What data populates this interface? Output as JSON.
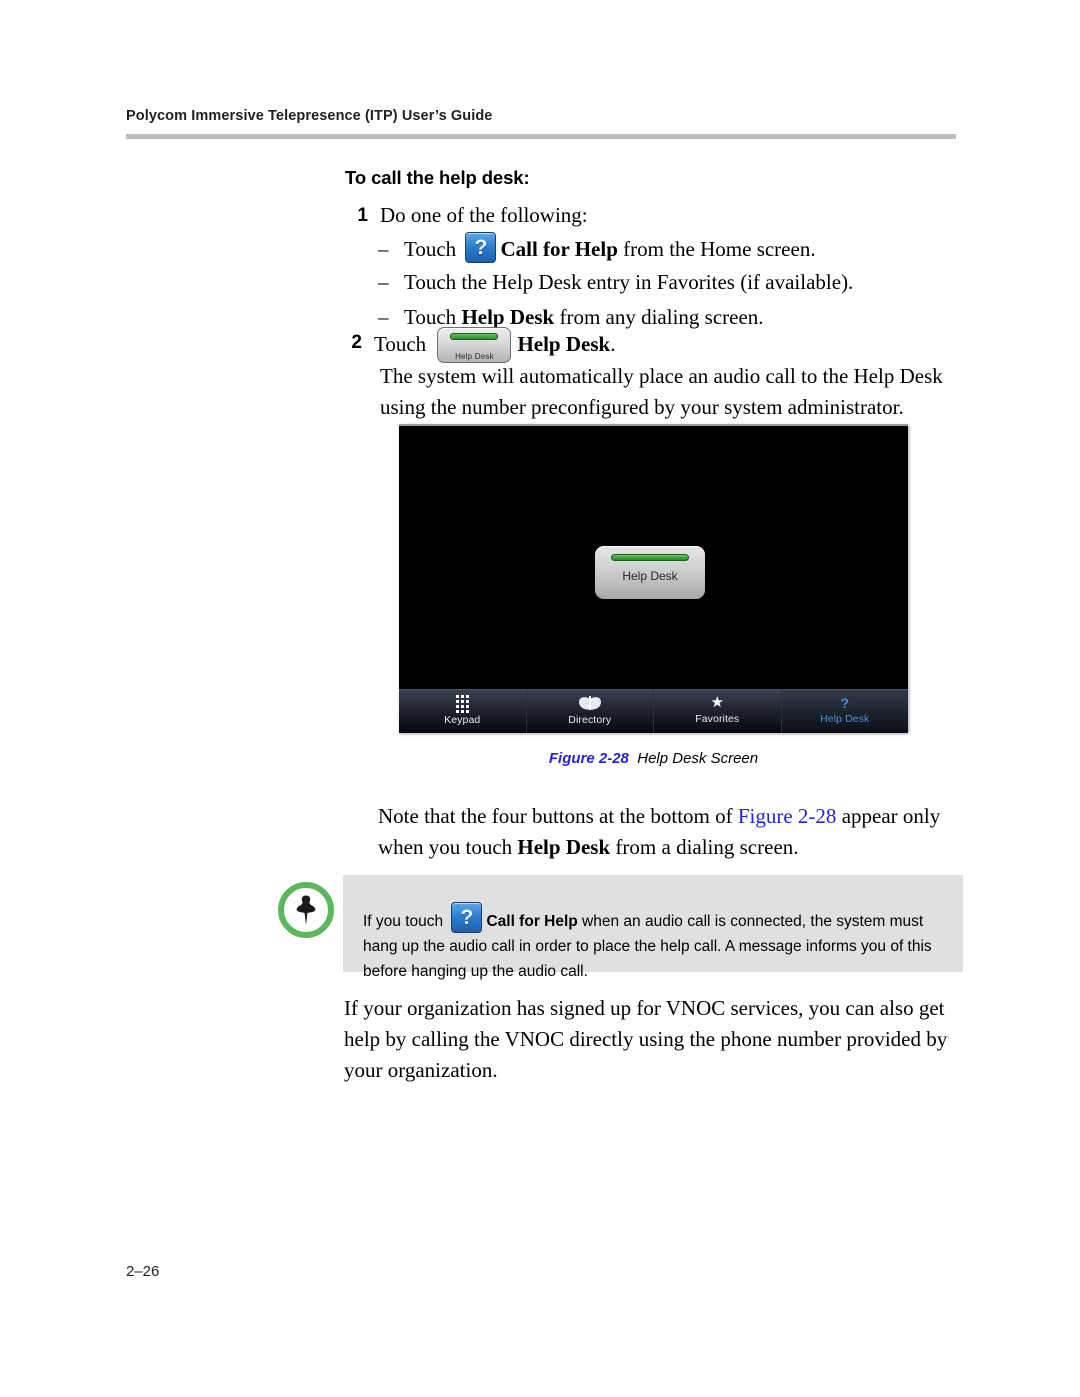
{
  "header": {
    "running_head": "Polycom Immersive Telepresence (ITP) User’s Guide"
  },
  "section": {
    "title": "To call the help desk:"
  },
  "steps": [
    {
      "number": "1",
      "text": "Do one of the following:",
      "sub_items": [
        {
          "dash": "–",
          "before_icon": "Touch ",
          "icon": "help-question-icon",
          "bold_text": "Call for Help",
          "after": " from the Home screen."
        },
        {
          "dash": "–",
          "text": "Touch the Help Desk entry in Favorites (if available)."
        },
        {
          "dash": "–",
          "before": "Touch ",
          "bold_text": "Help Desk",
          "after": " from any dialing screen."
        }
      ]
    },
    {
      "number": "2",
      "before_icon": "Touch ",
      "icon": "help-desk-button-icon",
      "icon_label": "Help Desk",
      "bold_text": "Help Desk",
      "after": ".",
      "body": "The system will automatically place an audio call to the Help Desk using the number preconfigured by your system administrator."
    }
  ],
  "figure": {
    "screen": {
      "help_desk_button_label": "Help Desk",
      "toolbar": [
        {
          "label": "Keypad",
          "icon": "keypad-grid-icon",
          "active": false
        },
        {
          "label": "Directory",
          "icon": "directory-book-icon",
          "active": false
        },
        {
          "label": "Favorites",
          "icon": "star-icon",
          "active": false
        },
        {
          "label": "Help Desk",
          "icon": "question-mark-icon",
          "active": true
        }
      ]
    },
    "caption_number": "Figure 2-28",
    "caption_title": "Help Desk Screen"
  },
  "body_paragraphs": {
    "note_about_buttons": {
      "part1": "Note that the four buttons at the bottom of ",
      "xref": "Figure 2-28",
      "part2": " appear only when you touch ",
      "bold": "Help Desk",
      "part3": " from a dialing screen."
    },
    "vnoc": "If your organization has signed up for VNOC services, you can also get help by calling the VNOC directly using the phone number provided by your organization."
  },
  "note_box": {
    "icon": "pushpin-note-icon",
    "accent_color": "#5cb85c",
    "background_color": "#e0e0e0",
    "part1": "If you touch ",
    "icon_inline": "help-question-icon",
    "bold": "Call for Help",
    "part2": " when an audio call is connected, the system must hang up the audio call in order to place the help call. A message informs you of this before hanging up the audio call."
  },
  "footer": {
    "page_number": "2–26"
  },
  "colors": {
    "rule": "#bcbcbc",
    "xref_blue": "#2424d6",
    "toolbar_active_blue": "#4d8fe0",
    "note_green": "#5cb85c",
    "note_gray": "#e0e0e0"
  }
}
